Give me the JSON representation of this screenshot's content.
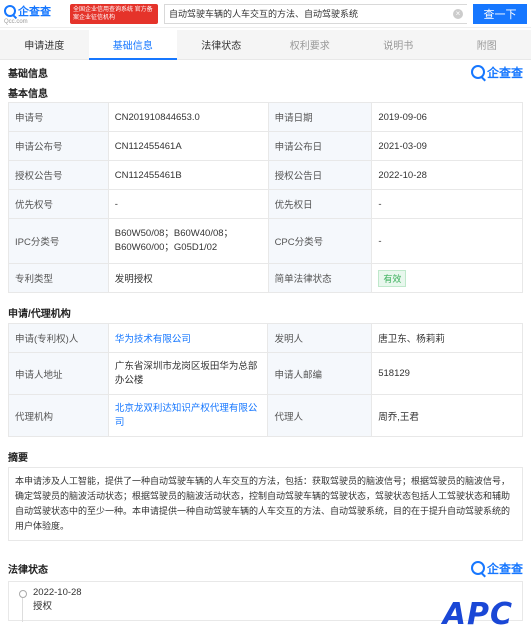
{
  "header": {
    "logo_text": "企查查",
    "logo_sub": "Qcc.com",
    "official_badge": "全国企业信用查询系统 官方备案企业征信机构",
    "search_value": "自动驾驶车辆的人车交互的方法、自动驾驶系统",
    "search_clear": "×",
    "search_button": "查一下"
  },
  "tabs": [
    {
      "label": "申请进度"
    },
    {
      "label": "基础信息"
    },
    {
      "label": "法律状态"
    },
    {
      "label": "权利要求"
    },
    {
      "label": "说明书"
    },
    {
      "label": "附图"
    }
  ],
  "brand_mark": "企查查",
  "basic": {
    "section": "基础信息",
    "subsection": "基本信息",
    "rows": [
      {
        "k1": "申请号",
        "v1": "CN201910844653.0",
        "k2": "申请日期",
        "v2": "2019-09-06"
      },
      {
        "k1": "申请公布号",
        "v1": "CN112455461A",
        "k2": "申请公布日",
        "v2": "2021-03-09"
      },
      {
        "k1": "授权公告号",
        "v1": "CN112455461B",
        "k2": "授权公告日",
        "v2": "2022-10-28"
      },
      {
        "k1": "优先权号",
        "v1": "-",
        "k2": "优先权日",
        "v2": "-"
      },
      {
        "k1": "IPC分类号",
        "v1": "B60W50/08；B60W40/08；B60W60/00；G05D1/02",
        "k2": "CPC分类号",
        "v2": "-"
      },
      {
        "k1": "专利类型",
        "v1": "发明授权",
        "k2": "简单法律状态",
        "v2": "有效"
      }
    ]
  },
  "agency": {
    "section": "申请/代理机构",
    "rows": [
      {
        "k1": "申请(专利权)人",
        "v1": "华为技术有限公司",
        "k2": "发明人",
        "v2": "唐卫东、杨莉莉"
      },
      {
        "k1": "申请人地址",
        "v1": "广东省深圳市龙岗区坂田华为总部办公楼",
        "k2": "申请人邮编",
        "v2": "518129"
      },
      {
        "k1": "代理机构",
        "v1": "北京龙双利达知识产权代理有限公司",
        "k2": "代理人",
        "v2": "周乔,王君"
      }
    ]
  },
  "abstract": {
    "section": "摘要",
    "text": "本申请涉及人工智能，提供了一种自动驾驶车辆的人车交互的方法，包括：获取驾驶员的脑波信号；根据驾驶员的脑波信号，确定驾驶员的脑波活动状态；根据驾驶员的脑波活动状态，控制自动驾驶车辆的驾驶状态，驾驶状态包括人工驾驶状态和辅助自动驾驶状态中的至少一种。本申请提供一种自动驾驶车辆的人车交互的方法、自动驾驶系统，目的在于提升自动驾驶系统的用户体验度。"
  },
  "legal": {
    "section": "法律状态",
    "date": "2022-10-28",
    "status": "授权"
  },
  "watermark": "APC",
  "colors": {
    "accent": "#1677ff",
    "active_status": "#3bb05c",
    "official_red": "#e5332a"
  }
}
